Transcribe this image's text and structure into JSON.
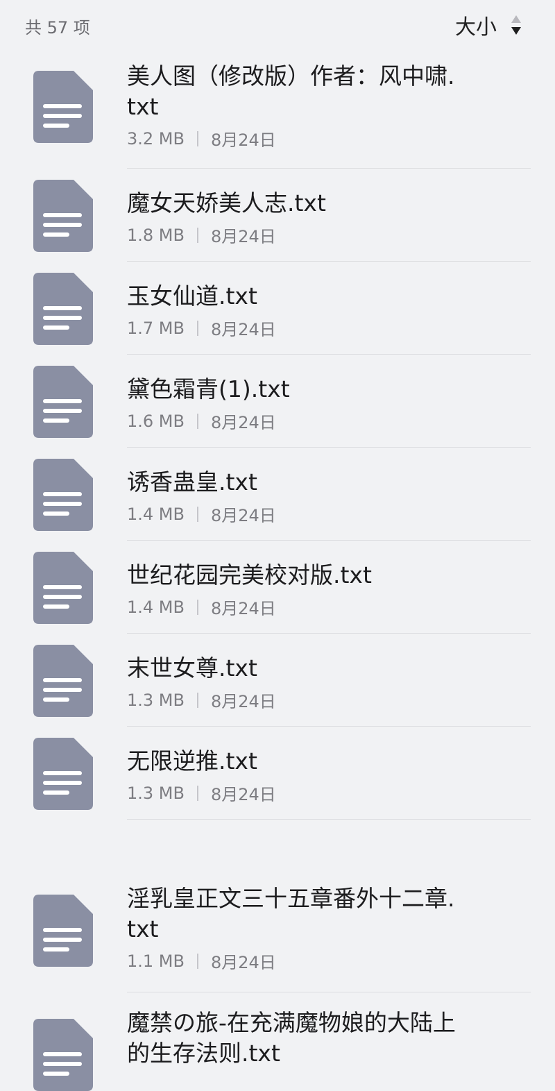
{
  "header": {
    "count_label": "共 57 项",
    "sort_label": "大小",
    "sort_icon": "sort-toggle-icon"
  },
  "colors": {
    "background": "#f1f2f4",
    "file_icon": "#8a8fa3"
  },
  "files": [
    {
      "name": "美人图（修改版）作者：风中啸.txt",
      "size": "3.2 MB",
      "date": "8月24日"
    },
    {
      "name": "魔女天娇美人志.txt",
      "size": "1.8 MB",
      "date": "8月24日"
    },
    {
      "name": "玉女仙道.txt",
      "size": "1.7 MB",
      "date": "8月24日"
    },
    {
      "name": "黛色霜青(1).txt",
      "size": "1.6 MB",
      "date": "8月24日"
    },
    {
      "name": "诱香蛊皇.txt",
      "size": "1.4 MB",
      "date": "8月24日"
    },
    {
      "name": "世纪花园完美校对版.txt",
      "size": "1.4 MB",
      "date": "8月24日"
    },
    {
      "name": "末世女尊.txt",
      "size": "1.3 MB",
      "date": "8月24日"
    },
    {
      "name": "无限逆推.txt",
      "size": "1.3 MB",
      "date": "8月24日"
    },
    {
      "name": "淫乳皇正文三十五章番外十二章.txt",
      "size": "1.1 MB",
      "date": "8月24日"
    },
    {
      "name": "魔禁の旅-在充满魔物娘的大陆上的生存法则.txt",
      "size": "",
      "date": ""
    }
  ]
}
